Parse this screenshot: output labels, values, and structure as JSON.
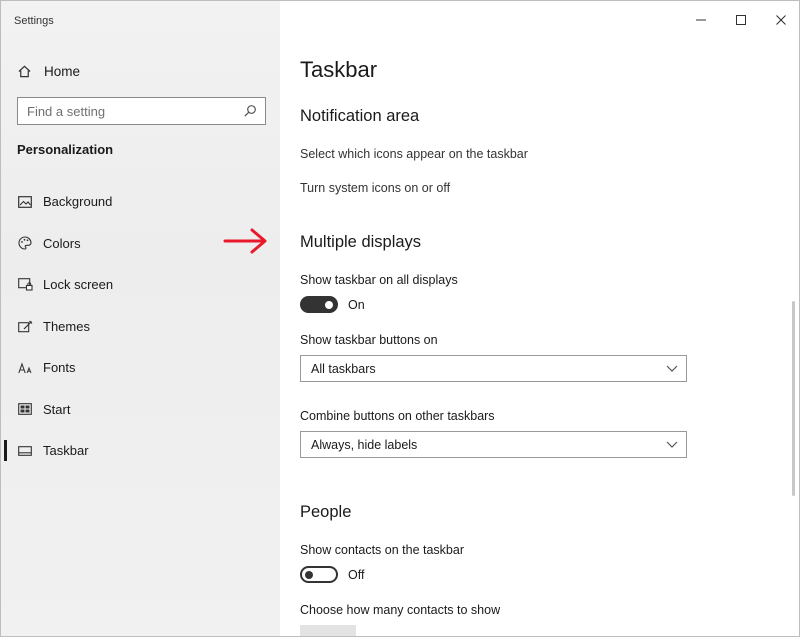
{
  "window": {
    "title": "Settings"
  },
  "sidebar": {
    "home_label": "Home",
    "search_placeholder": "Find a setting",
    "section_label": "Personalization",
    "items": [
      {
        "label": "Background",
        "icon": "picture-icon"
      },
      {
        "label": "Colors",
        "icon": "palette-icon"
      },
      {
        "label": "Lock screen",
        "icon": "lock-screen-icon"
      },
      {
        "label": "Themes",
        "icon": "themes-icon"
      },
      {
        "label": "Fonts",
        "icon": "fonts-icon"
      },
      {
        "label": "Start",
        "icon": "start-icon"
      },
      {
        "label": "Taskbar",
        "icon": "taskbar-icon",
        "active": true
      }
    ]
  },
  "main": {
    "title": "Taskbar",
    "notification_area": {
      "heading": "Notification area",
      "link1": "Select which icons appear on the taskbar",
      "link2": "Turn system icons on or off"
    },
    "multiple_displays": {
      "heading": "Multiple displays",
      "show_all_label": "Show taskbar on all displays",
      "show_all_state": "On",
      "buttons_on_label": "Show taskbar buttons on",
      "buttons_on_value": "All taskbars",
      "combine_label": "Combine buttons on other taskbars",
      "combine_value": "Always, hide labels"
    },
    "people": {
      "heading": "People",
      "show_contacts_label": "Show contacts on the taskbar",
      "show_contacts_state": "Off",
      "how_many_label": "Choose how many contacts to show"
    }
  },
  "colors": {
    "annotation_arrow": "#e8192c",
    "toggle_dark": "#333333"
  }
}
